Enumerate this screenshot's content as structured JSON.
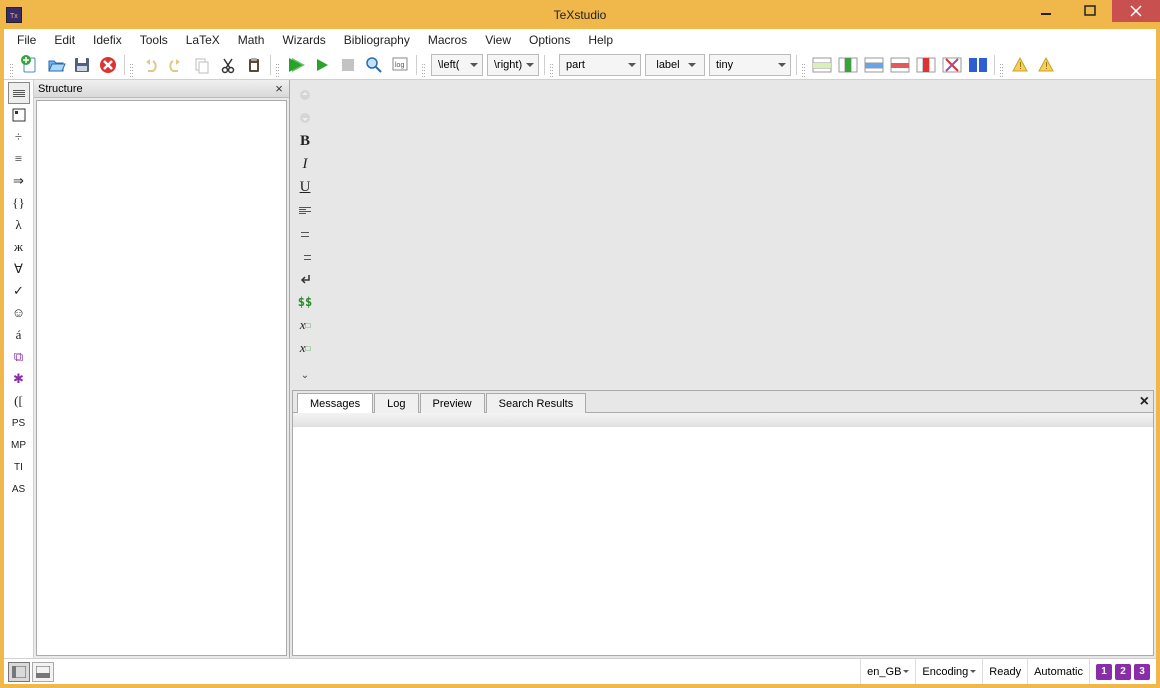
{
  "title": "TeXstudio",
  "menubar": [
    "File",
    "Edit",
    "Idefix",
    "Tools",
    "LaTeX",
    "Math",
    "Wizards",
    "Bibliography",
    "Macros",
    "View",
    "Options",
    "Help"
  ],
  "toolbar": {
    "combo_left": "\\left(",
    "combo_right": "\\right)",
    "combo_section": "part",
    "combo_ref": "label",
    "combo_size": "tiny"
  },
  "structure": {
    "title": "Structure"
  },
  "output_tabs": {
    "messages": "Messages",
    "log": "Log",
    "preview": "Preview",
    "search_results": "Search Results"
  },
  "statusbar": {
    "lang": "en_GB",
    "encoding": "Encoding",
    "ready": "Ready",
    "automatic": "Automatic"
  },
  "bookmarks": [
    "1",
    "2",
    "3"
  ]
}
